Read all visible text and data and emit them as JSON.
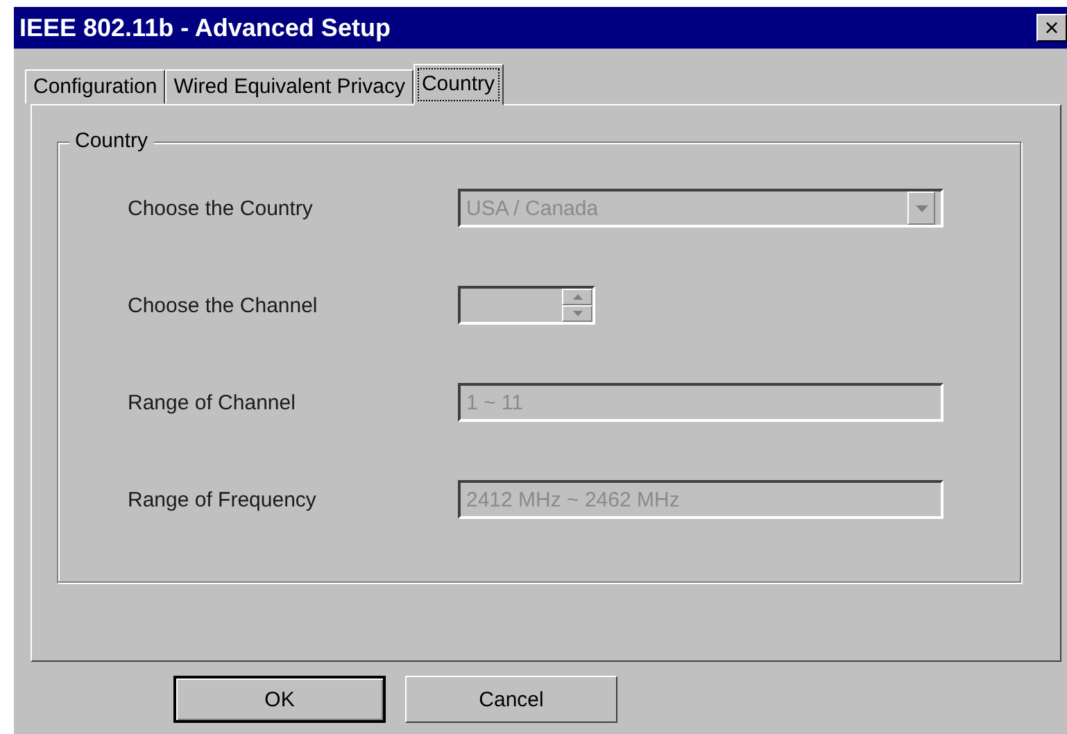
{
  "window": {
    "title": "IEEE 802.11b - Advanced Setup",
    "close": "×"
  },
  "tabs": [
    {
      "label": "Configuration",
      "selected": false
    },
    {
      "label": "Wired Equivalent Privacy",
      "selected": false
    },
    {
      "label": "Country",
      "selected": true
    }
  ],
  "group": {
    "title": "Country"
  },
  "fields": [
    {
      "kind": "combo",
      "label": "Choose the Country",
      "value": "USA / Canada",
      "disabled": true
    },
    {
      "kind": "spin",
      "label": "Choose the Channel",
      "disabled": true
    },
    {
      "kind": "text",
      "label": "Range of Channel",
      "value": "1 ~ 11",
      "disabled": true
    },
    {
      "kind": "text",
      "label": "Range of Frequency",
      "value": "2412 MHz ~ 2462 MHz",
      "disabled": true
    }
  ],
  "buttons": [
    {
      "label": "OK",
      "default": true
    },
    {
      "label": "Cancel",
      "default": false
    }
  ]
}
